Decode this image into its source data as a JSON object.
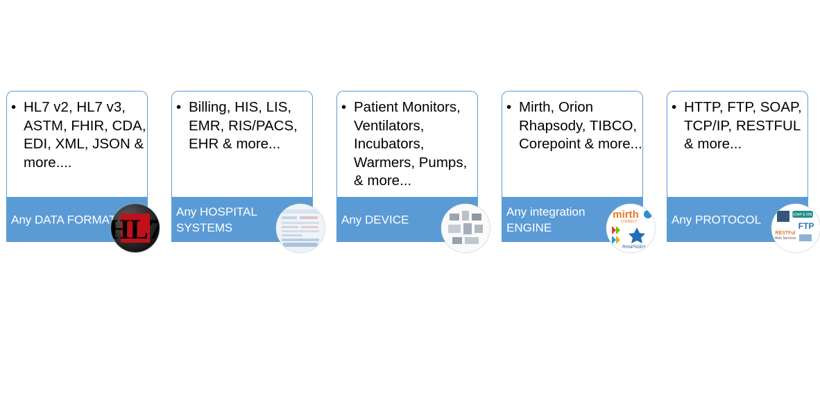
{
  "cards": [
    {
      "bullet": "HL7 v2, HL7 v3, ASTM, FHIR, CDA, EDI, XML, JSON & more....",
      "label": "Any DATA FORMAT"
    },
    {
      "bullet": "Billing, HIS, LIS, EMR, RIS/PACS, EHR & more...",
      "label": "Any HOSPITAL SYSTEMS"
    },
    {
      "bullet": "Patient Monitors, Ventilators, Incubators, Warmers, Pumps, & more...",
      "label": "Any DEVICE"
    },
    {
      "bullet": "Mirth, Orion Rhapsody, TIBCO, Corepoint & more...",
      "label": "Any integration ENGINE"
    },
    {
      "bullet": "HTTP, FTP, SOAP, TCP/IP, RESTFUL & more...",
      "label": "Any PROTOCOL"
    }
  ],
  "bullet_symbol": "•",
  "badges": {
    "hl7": "HL7",
    "mirth": "mirth",
    "mirth_sub": "CONNECT",
    "rhapsody": "RHAPSODY",
    "ftp": "FTP",
    "soap": "SOAP & XML",
    "restful": "RESTFul",
    "webservices": "Web Services"
  },
  "colors": {
    "accent": "#5b9bd5",
    "hl7_red": "#c0111b"
  }
}
